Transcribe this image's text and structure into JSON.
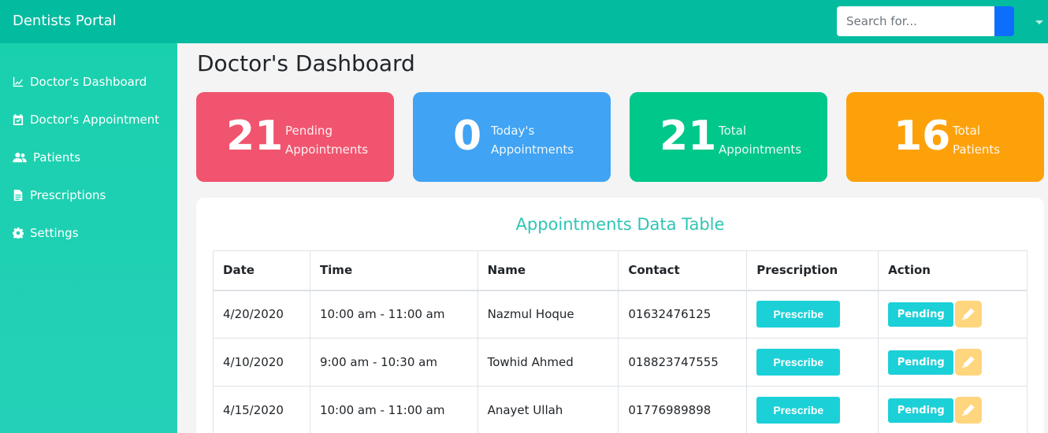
{
  "header": {
    "brand": "Dentists Portal",
    "search_placeholder": "Search for..."
  },
  "sidebar": {
    "items": [
      {
        "label": "Doctor's Dashboard",
        "icon": "chart-line-icon"
      },
      {
        "label": "Doctor's Appointment",
        "icon": "calendar-check-icon"
      },
      {
        "label": "Patients",
        "icon": "users-icon"
      },
      {
        "label": "Prescriptions",
        "icon": "file-icon"
      },
      {
        "label": "Settings",
        "icon": "gear-icon"
      }
    ]
  },
  "main": {
    "title": "Doctor's Dashboard",
    "stats": [
      {
        "value": "21",
        "line1": "Pending",
        "line2": "Appointments",
        "color": "#f1546e"
      },
      {
        "value": "0",
        "line1": "Today's",
        "line2": "Appointments",
        "color": "#40a3f3"
      },
      {
        "value": "21",
        "line1": "Total",
        "line2": "Appointments",
        "color": "#00c78a"
      },
      {
        "value": "16",
        "line1": "Total",
        "line2": "Patients",
        "color": "#fda10b"
      }
    ],
    "table": {
      "title": "Appointments Data Table",
      "headers": [
        "Date",
        "Time",
        "Name",
        "Contact",
        "Prescription",
        "Action"
      ],
      "rows": [
        {
          "date": "4/20/2020",
          "time": "10:00 am - 11:00 am",
          "name": "Nazmul Hoque",
          "contact": "01632476125",
          "prescribe": "Prescribe",
          "status": "Pending"
        },
        {
          "date": "4/10/2020",
          "time": "9:00 am - 10:30 am",
          "name": "Towhid Ahmed",
          "contact": "018823747555",
          "prescribe": "Prescribe",
          "status": "Pending"
        },
        {
          "date": "4/15/2020",
          "time": "10:00 am - 11:00 am",
          "name": "Anayet Ullah",
          "contact": "01776989898",
          "prescribe": "Prescribe",
          "status": "Pending"
        }
      ]
    }
  }
}
